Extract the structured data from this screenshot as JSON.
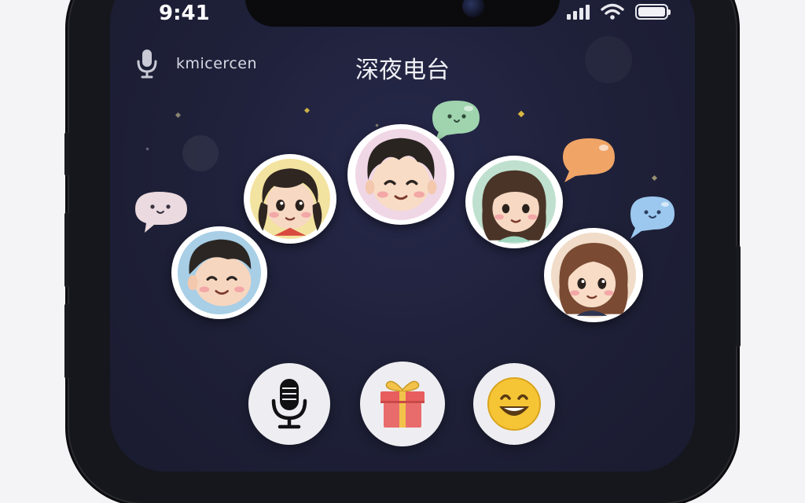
{
  "status_bar": {
    "time": "9:41",
    "signal_bars": 4,
    "wifi": "wifi-icon",
    "battery_level": 1.0
  },
  "header": {
    "username": "kmicercen",
    "mic_icon": "microphone-icon",
    "title": "深夜电台"
  },
  "participants": [
    {
      "name": "boy-laughing",
      "bubble_color": "#ebdadf"
    },
    {
      "name": "girl-pigtails",
      "bubble_color": ""
    },
    {
      "name": "boy-center",
      "bubble_color": "#9fd4ae"
    },
    {
      "name": "girl-long-hair",
      "bubble_color": "#f0a466"
    },
    {
      "name": "girl-brown-hair",
      "bubble_color": "#9cc8ef"
    }
  ],
  "controls": [
    {
      "name": "mic-button",
      "icon": "microphone-icon"
    },
    {
      "name": "gift-button",
      "icon": "gift-icon"
    },
    {
      "name": "emoji-button",
      "icon": "smiley-face-icon"
    }
  ],
  "colors": {
    "background": "#1e2038",
    "accent_gift": "#e85d5d",
    "accent_emoji": "#f6c535"
  }
}
